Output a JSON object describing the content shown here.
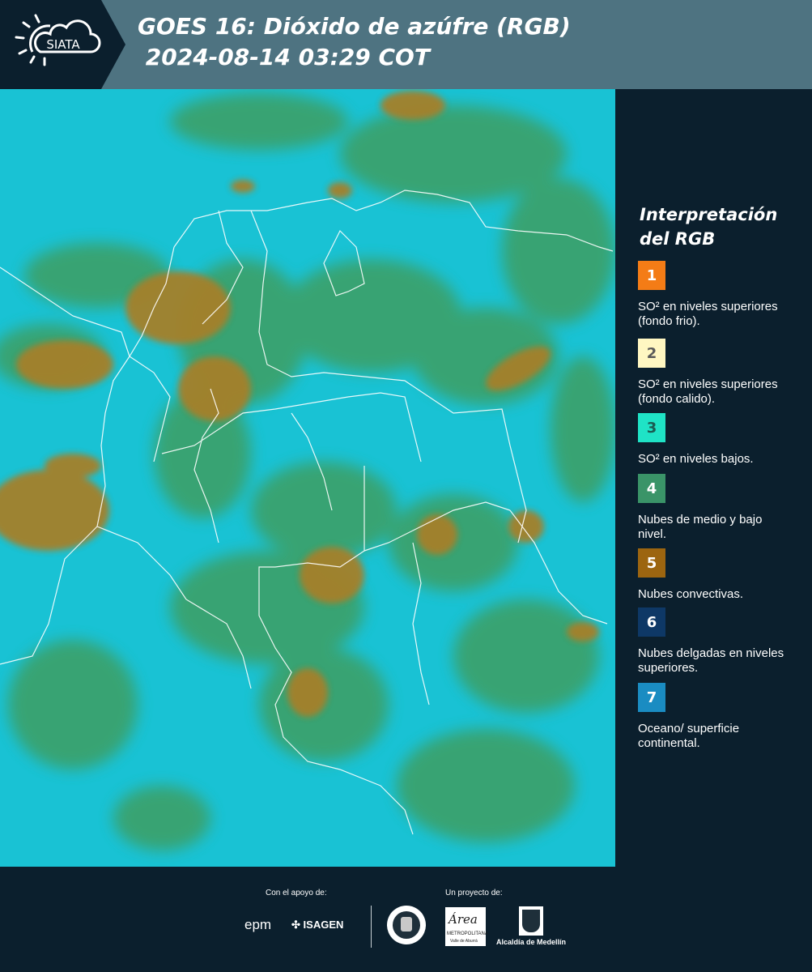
{
  "header": {
    "logo_text": "SIATA",
    "title_line1": "GOES 16: Dióxido de azúfre (RGB)",
    "title_line2": " 2024-08-14 03:29 COT",
    "background_color": "#4e7381"
  },
  "legend": {
    "title": "Interpretación del RGB",
    "items": [
      {
        "number": "1",
        "color": "#f47c16",
        "text_color": "#ffffff",
        "description": "SO² en niveles superiores (fondo frio)."
      },
      {
        "number": "2",
        "color": "#fff7c2",
        "text_color": "#5a5a5a",
        "description": "SO² en niveles superiores (fondo calido)."
      },
      {
        "number": "3",
        "color": "#1fe3c6",
        "text_color": "#1b5b52",
        "description": "SO² en niveles bajos."
      },
      {
        "number": "4",
        "color": "#3a9468",
        "text_color": "#ffffff",
        "description": "Nubes de medio y bajo nivel."
      },
      {
        "number": "5",
        "color": "#9c6510",
        "text_color": "#ffffff",
        "description": "Nubes convectivas."
      },
      {
        "number": "6",
        "color": "#0e3866",
        "text_color": "#ffffff",
        "description": "Nubes delgadas en niveles superiores."
      },
      {
        "number": "7",
        "color": "#1a8cc2",
        "text_color": "#ffffff",
        "description": "Oceano/ superficie continental."
      }
    ]
  },
  "map": {
    "icon": "satellite-rgb-map",
    "base_color": "#19c2d4",
    "cloud_green": "#3f9c5c",
    "cloud_brown": "#a5802a",
    "border_color": "#ffffff"
  },
  "footer": {
    "support_label": "Con el apoyo de:",
    "project_label": "Un proyecto de:",
    "sponsors": {
      "epm": "epm",
      "isagen": "ISAGEN",
      "area": "Área",
      "area_sub": "METROPOLITANA",
      "area_sub2": "Valle de Aburrá",
      "alcaldia": "Alcaldía de Medellín"
    }
  }
}
